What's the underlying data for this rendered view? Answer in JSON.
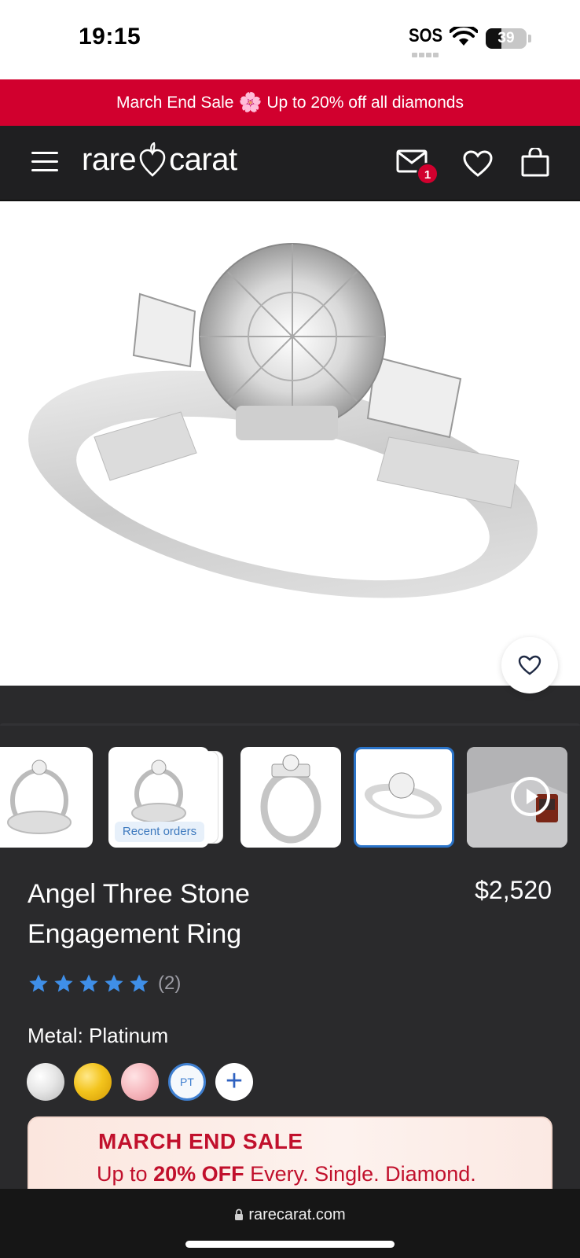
{
  "status_bar": {
    "time": "19:15",
    "carrier": "SOS",
    "battery": "39"
  },
  "promo": {
    "prefix": "March End Sale",
    "suffix": "Up to 20% off all diamonds",
    "icon": "flower-icon"
  },
  "nav": {
    "logo_left": "rare",
    "logo_right": "carat",
    "mail_badge": "1",
    "icons": [
      "menu-icon",
      "mail-icon",
      "heart-icon",
      "bag-icon"
    ]
  },
  "thumbnails": {
    "recent_orders_label": "Recent orders",
    "active_index": 3
  },
  "product": {
    "title": "Angel Three Stone Engagement Ring",
    "price": "$2,520",
    "rating": 5,
    "review_count": "(2)",
    "metal_label": "Metal:",
    "metal_value": "Platinum",
    "swatches": [
      {
        "name": "White Gold",
        "color": "#e6e6e6"
      },
      {
        "name": "Yellow Gold",
        "color": "#f3c41d"
      },
      {
        "name": "Rose Gold",
        "color": "#f6b8be"
      },
      {
        "name": "Platinum",
        "label": "PT",
        "selected": true
      },
      {
        "name": "More",
        "label": "+"
      }
    ]
  },
  "sale_card": {
    "title": "MARCH END SALE",
    "line_prefix": "Up to",
    "line_bold": "20% OFF",
    "line_suffix": "Every. Single. Diamond."
  },
  "browser": {
    "url": "rarecarat.com"
  },
  "colors": {
    "brand_red": "#d1002e",
    "accent_blue": "#3f8fe8",
    "dark_bg": "#2a2a2c"
  }
}
